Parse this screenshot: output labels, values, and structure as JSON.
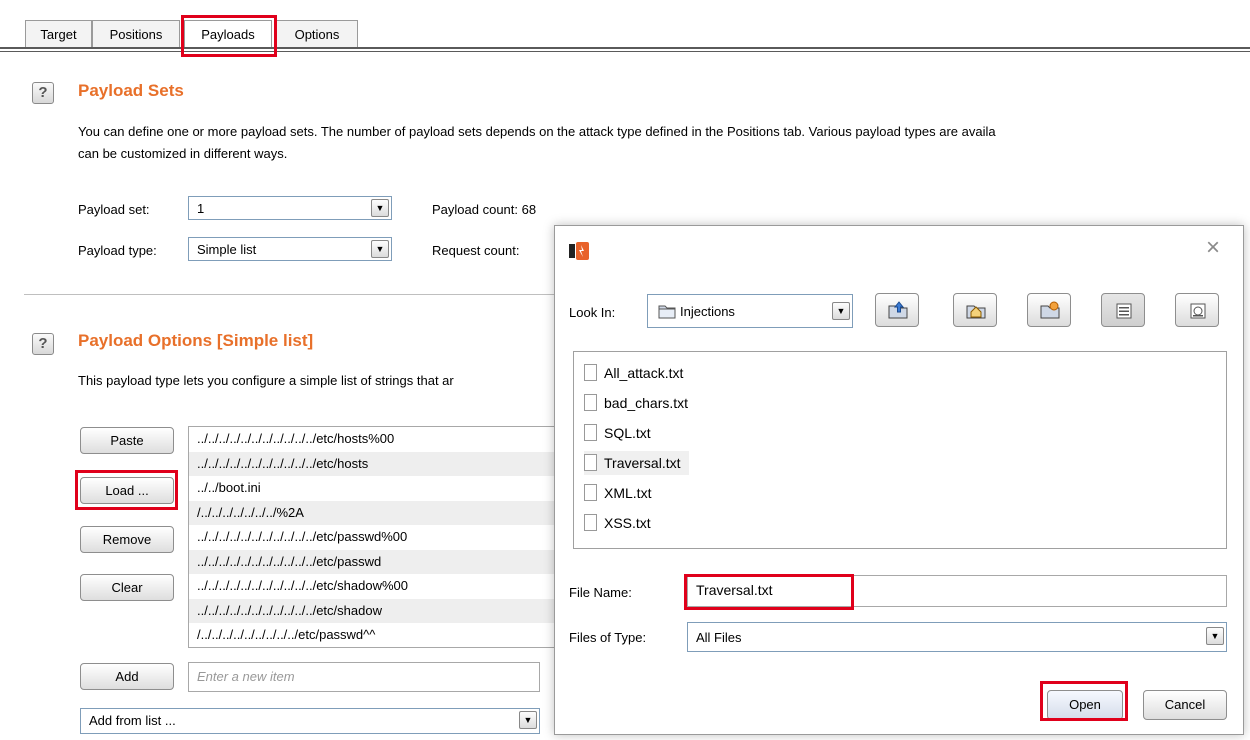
{
  "tabs": [
    {
      "label": "Target"
    },
    {
      "label": "Positions"
    },
    {
      "label": "Payloads"
    },
    {
      "label": "Options"
    }
  ],
  "payload_sets": {
    "help": "?",
    "title": "Payload Sets",
    "description_line1": "You can define one or more payload sets. The number of payload sets depends on the attack type defined in the Positions tab. Various payload types are availa",
    "description_line2": "can be customized in different ways.",
    "set_label": "Payload set:",
    "set_value": "1",
    "type_label": "Payload type:",
    "type_value": "Simple list",
    "count_label": "Payload count:",
    "count_value": "68",
    "request_label": "Request count:"
  },
  "payload_options": {
    "help": "?",
    "title": "Payload Options [Simple list]",
    "description": "This payload type lets you configure a simple list of strings that ar",
    "buttons": {
      "paste": "Paste",
      "load": "Load ...",
      "remove": "Remove",
      "clear": "Clear",
      "add": "Add"
    },
    "items": [
      "../../../../../../../../../../../etc/hosts%00",
      "../../../../../../../../../../../etc/hosts",
      "../../boot.ini",
      "/../../../../../../../%2A",
      "../../../../../../../../../../../etc/passwd%00",
      "../../../../../../../../../../../etc/passwd",
      "../../../../../../../../../../../etc/shadow%00",
      "../../../../../../../../../../../etc/shadow",
      "/../../../../../../../../../etc/passwd^^"
    ],
    "new_item_placeholder": "Enter a new item",
    "add_from_list": "Add from list ..."
  },
  "dialog": {
    "close_glyph": "×",
    "look_in_label": "Look In:",
    "look_in_value": "Injections",
    "files": [
      "All_attack.txt",
      "bad_chars.txt",
      "SQL.txt",
      "Traversal.txt",
      "XML.txt",
      "XSS.txt"
    ],
    "selected_file": "Traversal.txt",
    "file_name_label": "File Name:",
    "file_name_value": "Traversal.txt",
    "files_of_type_label": "Files of Type:",
    "files_of_type_value": "All Files",
    "open_button": "Open",
    "cancel_button": "Cancel"
  },
  "colors": {
    "section_title": "#e8702a",
    "highlight_box": "#e0001b",
    "app_icon": "#e8622a"
  }
}
